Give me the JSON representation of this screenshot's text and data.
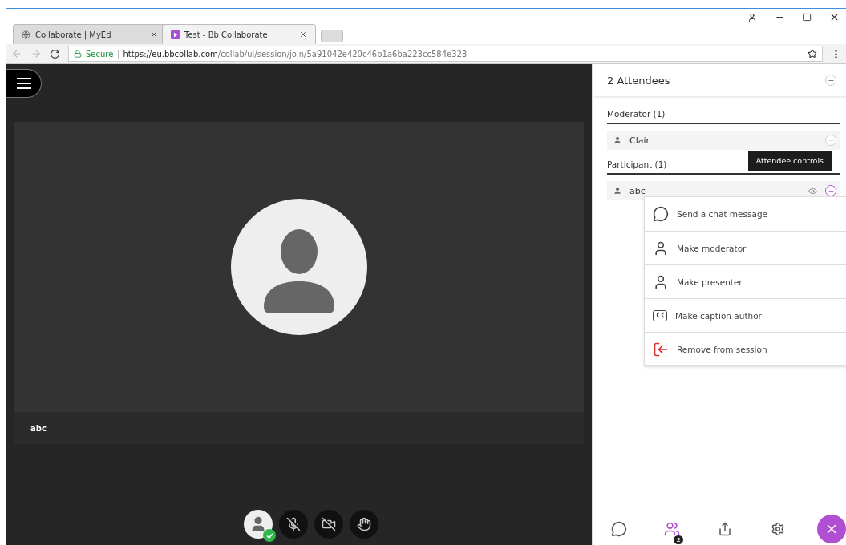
{
  "browser": {
    "tabs": [
      {
        "label": "Collaborate | MyEd",
        "selected": false
      },
      {
        "label": "Test - Bb Collaborate",
        "selected": true
      }
    ],
    "address": {
      "secure_label": "Secure",
      "url_host": "https://eu.bbcollab.com",
      "url_path": "/collab/ui/session/join/5a91042e420c46b1a6ba223cc584e323"
    }
  },
  "stage": {
    "tile_name": "abc"
  },
  "panel": {
    "title": "2 Attendees",
    "groups": [
      {
        "heading": "Moderator (1)",
        "attendees": [
          {
            "name": "Clair",
            "controls_open": false
          }
        ]
      },
      {
        "heading": "Participant (1)",
        "attendees": [
          {
            "name": "abc",
            "controls_open": true
          }
        ]
      }
    ],
    "tooltip": "Attendee controls",
    "menu": [
      {
        "kind": "chat",
        "label": "Send a chat message"
      },
      {
        "kind": "moderator",
        "label": "Make moderator"
      },
      {
        "kind": "presenter",
        "label": "Make presenter"
      },
      {
        "kind": "caption",
        "label": "Make caption author"
      },
      {
        "kind": "remove",
        "label": "Remove from session"
      }
    ],
    "tabs": [
      {
        "kind": "chat",
        "selected": false
      },
      {
        "kind": "attendees",
        "selected": true,
        "badge": "2"
      },
      {
        "kind": "share",
        "selected": false
      },
      {
        "kind": "settings",
        "selected": false
      }
    ]
  }
}
